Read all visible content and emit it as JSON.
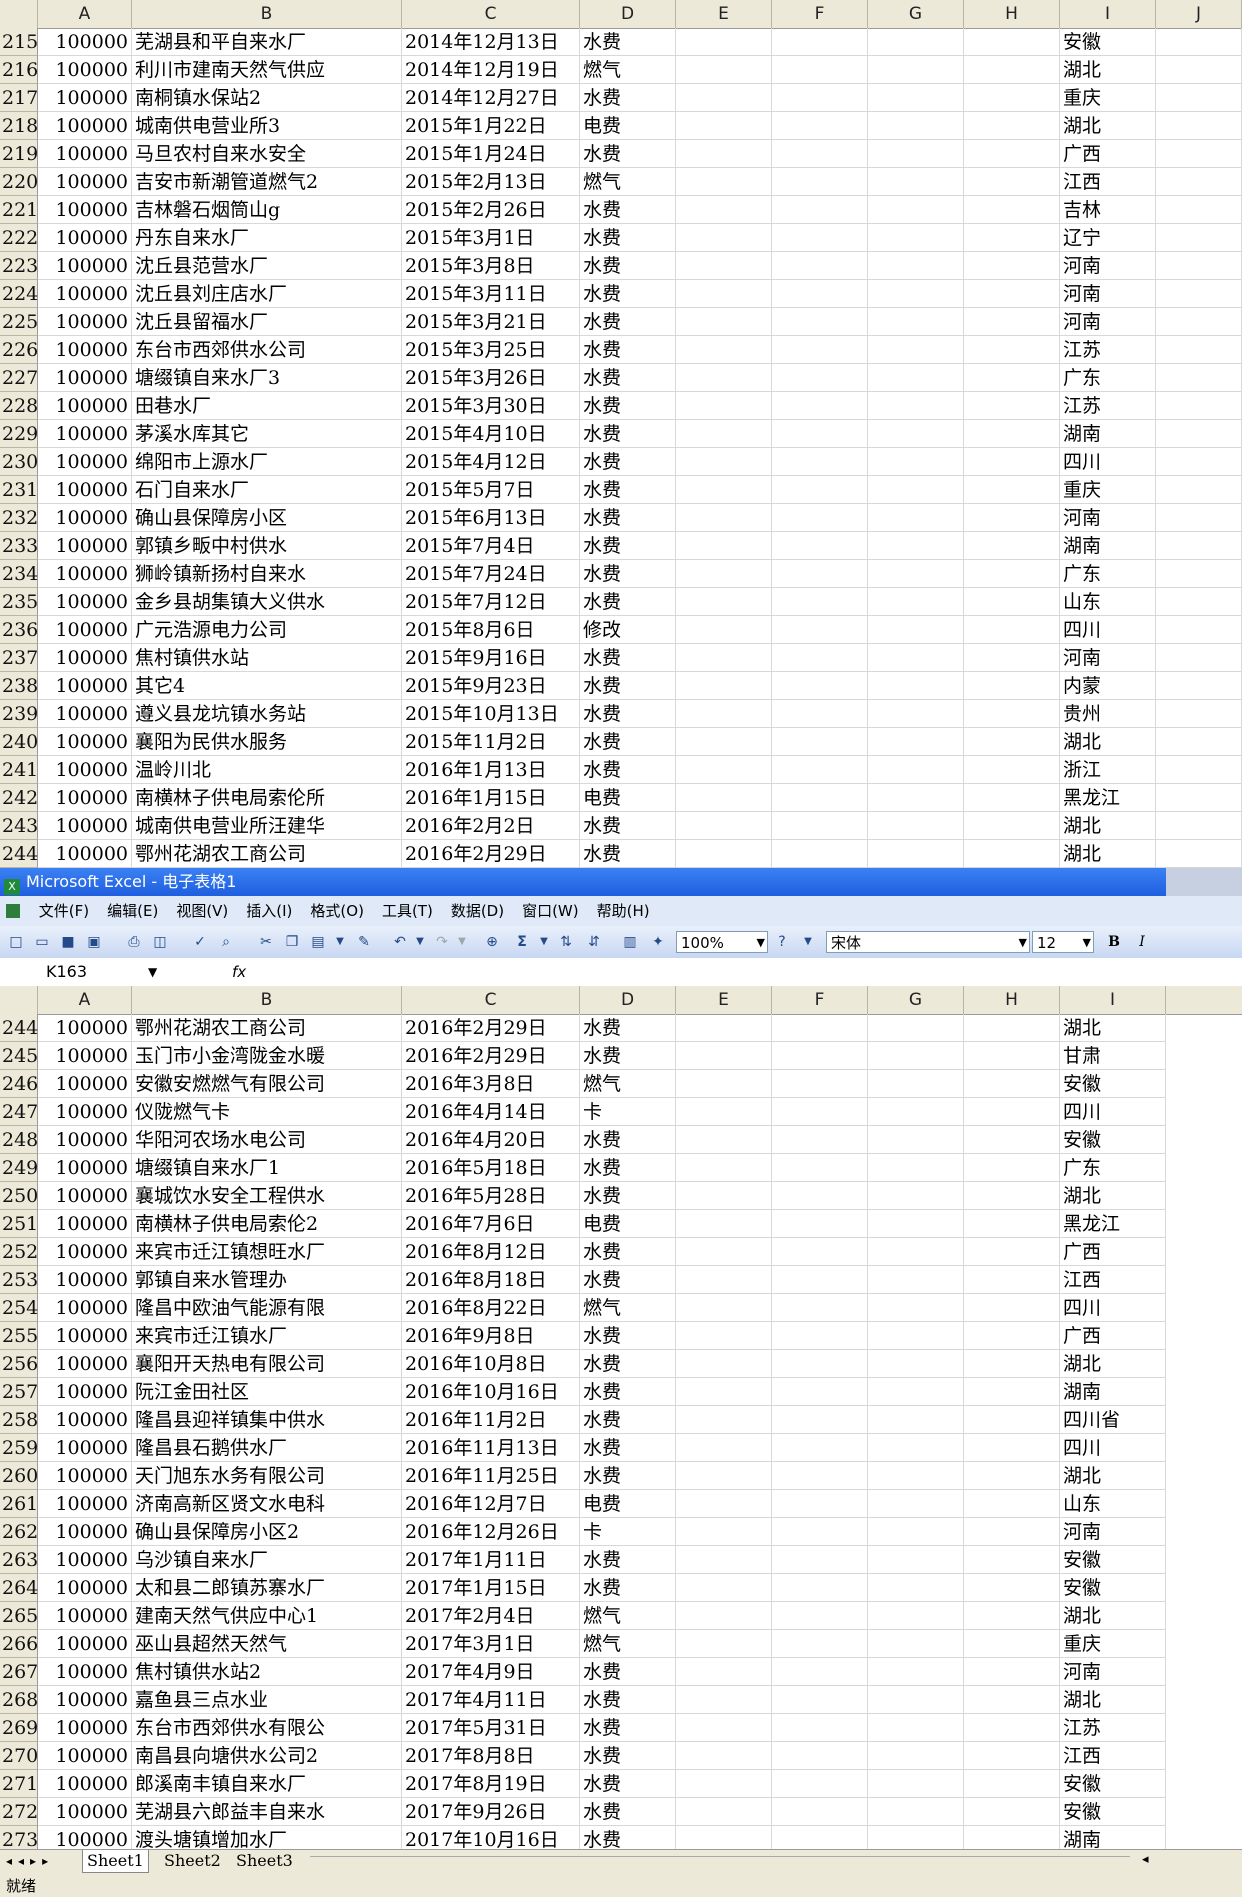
{
  "app": {
    "title": "Microsoft Excel - 电子表格1",
    "menu": [
      "文件(F)",
      "编辑(E)",
      "视图(V)",
      "插入(I)",
      "格式(O)",
      "工具(T)",
      "数据(D)",
      "窗口(W)",
      "帮助(H)"
    ],
    "zoom": "100%",
    "font": "宋体",
    "font_size": "12",
    "name_box": "K163",
    "fx_label": "fx",
    "status": "就绪",
    "sheets": [
      "Sheet1",
      "Sheet2",
      "Sheet3"
    ]
  },
  "columns_top": [
    "A",
    "B",
    "C",
    "D",
    "E",
    "F",
    "G",
    "H",
    "I",
    "J"
  ],
  "columns_bottom": [
    "A",
    "B",
    "C",
    "D",
    "E",
    "F",
    "G",
    "H",
    "I"
  ],
  "top_rows": [
    [
      "215",
      "100000",
      "芜湖县和平自来水厂",
      "2014年12月13日",
      "水费",
      "安徽"
    ],
    [
      "216",
      "100000",
      "利川市建南天然气供应",
      "2014年12月19日",
      "燃气",
      "湖北"
    ],
    [
      "217",
      "100000",
      "南桐镇水保站2",
      "2014年12月27日",
      "水费",
      "重庆"
    ],
    [
      "218",
      "100000",
      "城南供电营业所3",
      "2015年1月22日",
      "电费",
      "湖北"
    ],
    [
      "219",
      "100000",
      "马旦农村自来水安全",
      "2015年1月24日",
      "水费",
      "广西"
    ],
    [
      "220",
      "100000",
      "吉安市新潮管道燃气2",
      "2015年2月13日",
      "燃气",
      "江西"
    ],
    [
      "221",
      "100000",
      "吉林磐石烟筒山g",
      "2015年2月26日",
      "水费",
      "吉林"
    ],
    [
      "222",
      "100000",
      "丹东自来水厂",
      "2015年3月1日",
      "水费",
      "辽宁"
    ],
    [
      "223",
      "100000",
      "沈丘县范营水厂",
      "2015年3月8日",
      "水费",
      "河南"
    ],
    [
      "224",
      "100000",
      "沈丘县刘庄店水厂",
      "2015年3月11日",
      "水费",
      "河南"
    ],
    [
      "225",
      "100000",
      "沈丘县留福水厂",
      "2015年3月21日",
      "水费",
      "河南"
    ],
    [
      "226",
      "100000",
      "东台市西郊供水公司",
      "2015年3月25日",
      "水费",
      "江苏"
    ],
    [
      "227",
      "100000",
      "塘缀镇自来水厂3",
      "2015年3月26日",
      "水费",
      "广东"
    ],
    [
      "228",
      "100000",
      "田巷水厂",
      "2015年3月30日",
      "水费",
      "江苏"
    ],
    [
      "229",
      "100000",
      "茅溪水库其它",
      "2015年4月10日",
      "水费",
      "湖南"
    ],
    [
      "230",
      "100000",
      "绵阳市上源水厂",
      "2015年4月12日",
      "水费",
      "四川"
    ],
    [
      "231",
      "100000",
      "石门自来水厂",
      "2015年5月7日",
      "水费",
      "重庆"
    ],
    [
      "232",
      "100000",
      "确山县保障房小区",
      "2015年6月13日",
      "水费",
      "河南"
    ],
    [
      "233",
      "100000",
      "郭镇乡畈中村供水",
      "2015年7月4日",
      "水费",
      "湖南"
    ],
    [
      "234",
      "100000",
      "狮岭镇新扬村自来水",
      "2015年7月24日",
      "水费",
      "广东"
    ],
    [
      "235",
      "100000",
      "金乡县胡集镇大义供水",
      "2015年7月12日",
      "水费",
      "山东"
    ],
    [
      "236",
      "100000",
      "广元浩源电力公司",
      "2015年8月6日",
      "修改",
      "四川"
    ],
    [
      "237",
      "100000",
      "焦村镇供水站",
      "2015年9月16日",
      "水费",
      "河南"
    ],
    [
      "238",
      "100000",
      "其它4",
      "2015年9月23日",
      "水费",
      "内蒙"
    ],
    [
      "239",
      "100000",
      "遵义县龙坑镇水务站",
      "2015年10月13日",
      "水费",
      "贵州"
    ],
    [
      "240",
      "100000",
      "襄阳为民供水服务",
      "2015年11月2日",
      "水费",
      "湖北"
    ],
    [
      "241",
      "100000",
      "温岭川北",
      "2016年1月13日",
      "水费",
      "浙江"
    ],
    [
      "242",
      "100000",
      "南横林子供电局索伦所",
      "2016年1月15日",
      "电费",
      "黑龙江"
    ],
    [
      "243",
      "100000",
      "城南供电营业所汪建华",
      "2016年2月2日",
      "水费",
      "湖北"
    ],
    [
      "244",
      "100000",
      "鄂州花湖农工商公司",
      "2016年2月29日",
      "水费",
      "湖北"
    ]
  ],
  "bottom_rows": [
    [
      "244",
      "100000",
      "鄂州花湖农工商公司",
      "2016年2月29日",
      "水费",
      "湖北"
    ],
    [
      "245",
      "100000",
      "玉门市小金湾陇金水暖",
      "2016年2月29日",
      "水费",
      "甘肃"
    ],
    [
      "246",
      "100000",
      "安徽安燃燃气有限公司",
      "2016年3月8日",
      "燃气",
      "安徽"
    ],
    [
      "247",
      "100000",
      "仪陇燃气卡",
      "2016年4月14日",
      "卡",
      "四川"
    ],
    [
      "248",
      "100000",
      "华阳河农场水电公司",
      "2016年4月20日",
      "水费",
      "安徽"
    ],
    [
      "249",
      "100000",
      "塘缀镇自来水厂1",
      "2016年5月18日",
      "水费",
      "广东"
    ],
    [
      "250",
      "100000",
      "襄城饮水安全工程供水",
      "2016年5月28日",
      "水费",
      "湖北"
    ],
    [
      "251",
      "100000",
      "南横林子供电局索伦2",
      "2016年7月6日",
      "电费",
      "黑龙江"
    ],
    [
      "252",
      "100000",
      "来宾市迁江镇想旺水厂",
      "2016年8月12日",
      "水费",
      "广西"
    ],
    [
      "253",
      "100000",
      "郭镇自来水管理办",
      "2016年8月18日",
      "水费",
      "江西"
    ],
    [
      "254",
      "100000",
      "隆昌中欧油气能源有限",
      "2016年8月22日",
      "燃气",
      "四川"
    ],
    [
      "255",
      "100000",
      "来宾市迁江镇水厂",
      "2016年9月8日",
      "水费",
      "广西"
    ],
    [
      "256",
      "100000",
      "襄阳开天热电有限公司",
      "2016年10月8日",
      "水费",
      "湖北"
    ],
    [
      "257",
      "100000",
      "阮江金田社区",
      "2016年10月16日",
      "水费",
      "湖南"
    ],
    [
      "258",
      "100000",
      "隆昌县迎祥镇集中供水",
      "2016年11月2日",
      "水费",
      "四川省"
    ],
    [
      "259",
      "100000",
      "隆昌县石鹅供水厂",
      "2016年11月13日",
      "水费",
      "四川"
    ],
    [
      "260",
      "100000",
      "天门旭东水务有限公司",
      "2016年11月25日",
      "水费",
      "湖北"
    ],
    [
      "261",
      "100000",
      "济南高新区贤文水电科",
      "2016年12月7日",
      "电费",
      "山东"
    ],
    [
      "262",
      "100000",
      "确山县保障房小区2",
      "2016年12月26日",
      "卡",
      "河南"
    ],
    [
      "263",
      "100000",
      "乌沙镇自来水厂",
      "2017年1月11日",
      "水费",
      "安徽"
    ],
    [
      "264",
      "100000",
      "太和县二郎镇苏寨水厂",
      "2017年1月15日",
      "水费",
      "安徽"
    ],
    [
      "265",
      "100000",
      "建南天然气供应中心1",
      "2017年2月4日",
      "燃气",
      "湖北"
    ],
    [
      "266",
      "100000",
      "巫山县超然天然气",
      "2017年3月1日",
      "燃气",
      "重庆"
    ],
    [
      "267",
      "100000",
      "焦村镇供水站2",
      "2017年4月9日",
      "水费",
      "河南"
    ],
    [
      "268",
      "100000",
      "嘉鱼县三点水业",
      "2017年4月11日",
      "水费",
      "湖北"
    ],
    [
      "269",
      "100000",
      "东台市西郊供水有限公",
      "2017年5月31日",
      "水费",
      "江苏"
    ],
    [
      "270",
      "100000",
      "南昌县向塘供水公司2",
      "2017年8月8日",
      "水费",
      "江西"
    ],
    [
      "271",
      "100000",
      "郎溪南丰镇自来水厂",
      "2017年8月19日",
      "水费",
      "安徽"
    ],
    [
      "272",
      "100000",
      "芜湖县六郎益丰自来水",
      "2017年9月26日",
      "水费",
      "安徽"
    ],
    [
      "273",
      "100000",
      "渡头塘镇增加水厂",
      "2017年10月16日",
      "水费",
      "湖南"
    ]
  ]
}
